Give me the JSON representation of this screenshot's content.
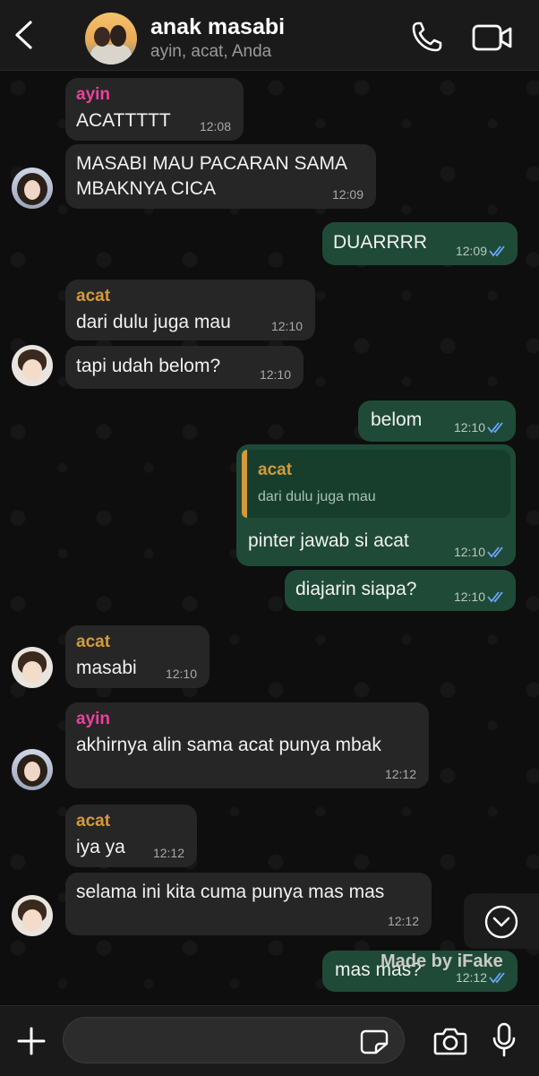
{
  "header": {
    "title": "anak masabi",
    "members": "ayin, acat, Anda"
  },
  "colors": {
    "incoming_bubble": "#262626",
    "outgoing_bubble": "#1f4a37",
    "ayin_name": "#e8439c",
    "acat_name": "#d59a3a",
    "read_ticks": "#6aa8ff"
  },
  "messages": [
    {
      "sender": "ayin",
      "text": "ACATTTTT",
      "time": "12:08"
    },
    {
      "text": "MASABI MAU PACARAN SAMA MBAKNYA CICA",
      "time": "12:09"
    },
    {
      "text": "DUARRRR",
      "time": "12:09"
    },
    {
      "sender": "acat",
      "text": "dari dulu juga mau",
      "time": "12:10"
    },
    {
      "text": "tapi udah belom?",
      "time": "12:10"
    },
    {
      "text": "belom",
      "time": "12:10"
    },
    {
      "reply_name": "acat",
      "reply_text": "dari dulu juga mau",
      "text": "pinter jawab si acat",
      "time": "12:10"
    },
    {
      "text": "diajarin siapa?",
      "time": "12:10"
    },
    {
      "sender": "acat",
      "text": "masabi",
      "time": "12:10"
    },
    {
      "sender": "ayin",
      "text": "akhirnya alin sama acat punya mbak",
      "time": "12:12"
    },
    {
      "sender": "acat",
      "text": "iya ya",
      "time": "12:12"
    },
    {
      "text": "selama ini kita cuma punya mas mas",
      "time": "12:12"
    },
    {
      "text": "mas mas?",
      "time": "12:12"
    }
  ],
  "watermark": "Made by iFake",
  "composer": {
    "placeholder": ""
  }
}
